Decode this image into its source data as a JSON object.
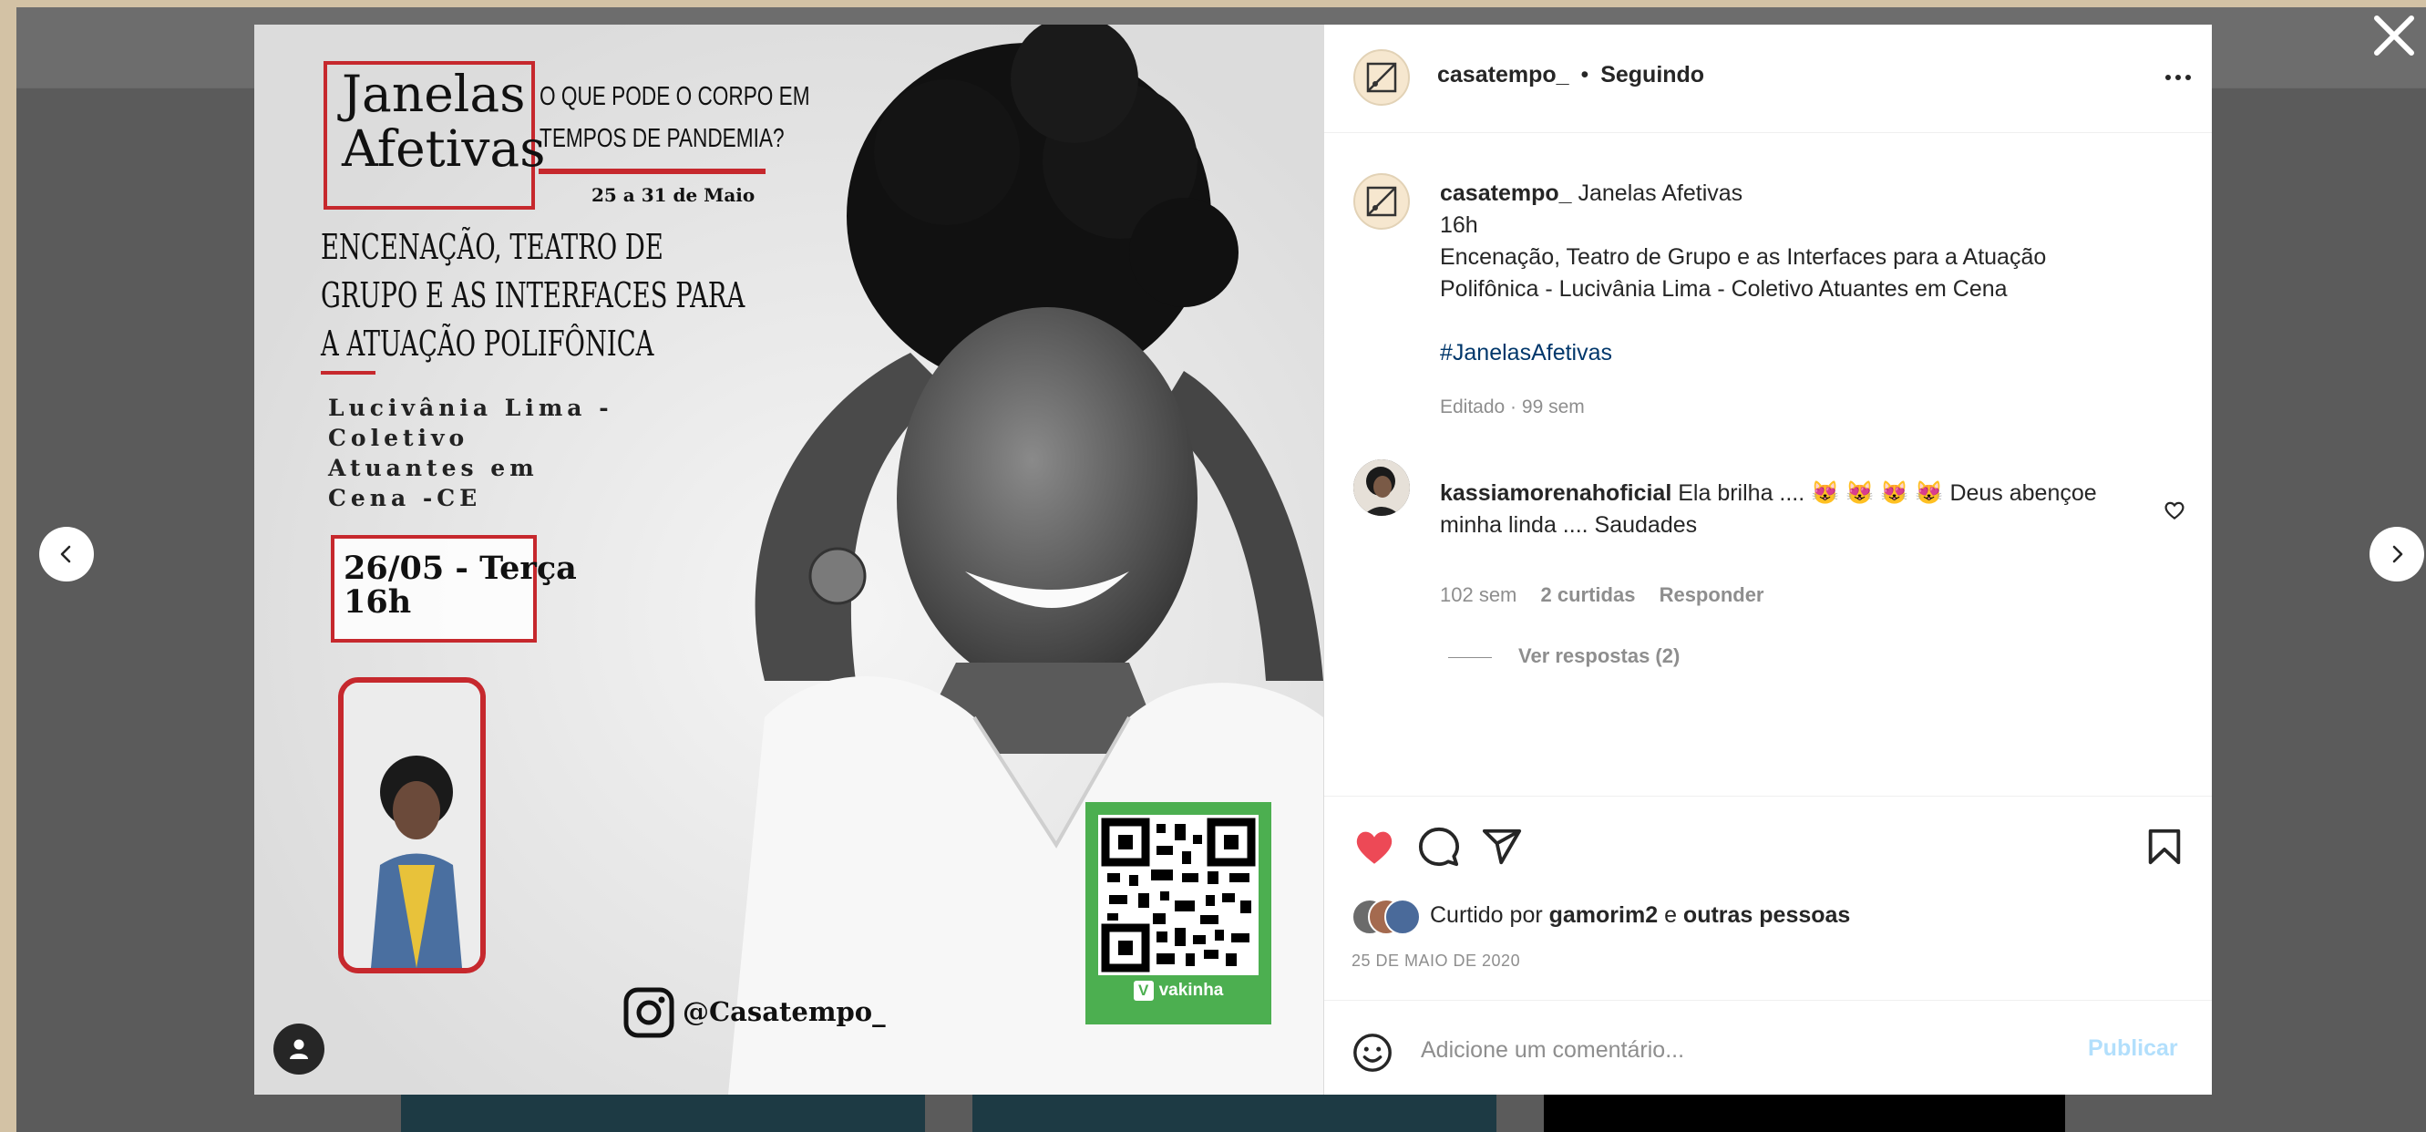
{
  "post": {
    "account": "casatempo_",
    "follow_status": "Seguindo",
    "caption_title": "Janelas Afetivas",
    "caption_time": "16h",
    "caption_line1": "Encenação, Teatro de Grupo e as Interfaces para a Atuação",
    "caption_line2": "Polifônica - Lucivânia Lima - Coletivo Atuantes em Cena",
    "hashtag": "#JanelasAfetivas",
    "edited": "Editado · 99 sem",
    "liked_by_prefix": "Curtido por",
    "liked_by_user": "gamorim2",
    "liked_by_conj": "e",
    "liked_by_others": "outras pessoas",
    "date": "25 DE MAIO DE 2020"
  },
  "comment": {
    "author": "kassiamorenahoficial",
    "text_line1": "Ela brilha .... 😻 😻 😻 😻 Deus abençoe",
    "text_line2": "minha linda .... Saudades",
    "age": "102 sem",
    "likes": "2 curtidas",
    "reply": "Responder",
    "view_replies": "Ver respostas (2)"
  },
  "comment_input": {
    "placeholder": "Adicione um comentário...",
    "publish": "Publicar"
  },
  "poster": {
    "title_line1": "Janelas",
    "title_line2": "Afetivas",
    "question_line1": "O QUE PODE O CORPO EM",
    "question_line2": "TEMPOS DE PANDEMIA?",
    "dates": "25 a 31 de Maio",
    "heading_line1": "ENCENAÇÃO, TEATRO DE",
    "heading_line2": "GRUPO E AS INTERFACES PARA",
    "heading_line3": "A ATUAÇÃO POLIFÔNICA",
    "speaker_line1": "Lucivânia Lima -",
    "speaker_line2": "Coletivo",
    "speaker_line3": "Atuantes em",
    "speaker_line4": "Cena -CE",
    "session_line1": "26/05 - Terça",
    "session_line2": "16h",
    "instagram": "@Casatempo_",
    "qr_label": "vakinha"
  },
  "colors": {
    "like_red": "#ed4956",
    "poster_red": "#c6282d",
    "qr_green": "#4caf50",
    "publish_blue": "#b2dffc"
  },
  "icons": [
    "close-icon",
    "chevron-left-icon",
    "chevron-right-icon",
    "more-icon",
    "heart-icon",
    "comment-icon",
    "share-icon",
    "bookmark-icon",
    "emoji-icon",
    "user-tag-icon",
    "instagram-icon"
  ]
}
